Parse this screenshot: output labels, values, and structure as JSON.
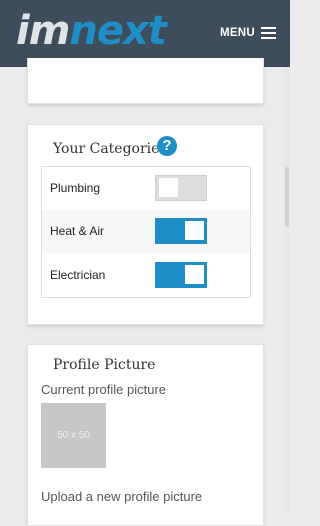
{
  "header": {
    "logo_part1": "im",
    "logo_part2": "next",
    "menu_label": "MENU"
  },
  "categories_card": {
    "title": "Your Categories",
    "help_glyph": "?",
    "items": [
      {
        "label": "Plumbing",
        "enabled": false
      },
      {
        "label": "Heat & Air",
        "enabled": true
      },
      {
        "label": "Electrician",
        "enabled": true
      }
    ]
  },
  "profile_card": {
    "title": "Profile Picture",
    "current_label": "Current profile picture",
    "placeholder_text": "50 x 50",
    "upload_label": "Upload a new profile picture"
  },
  "colors": {
    "header_bg": "#3d4d5c",
    "accent": "#1f8ec7"
  }
}
